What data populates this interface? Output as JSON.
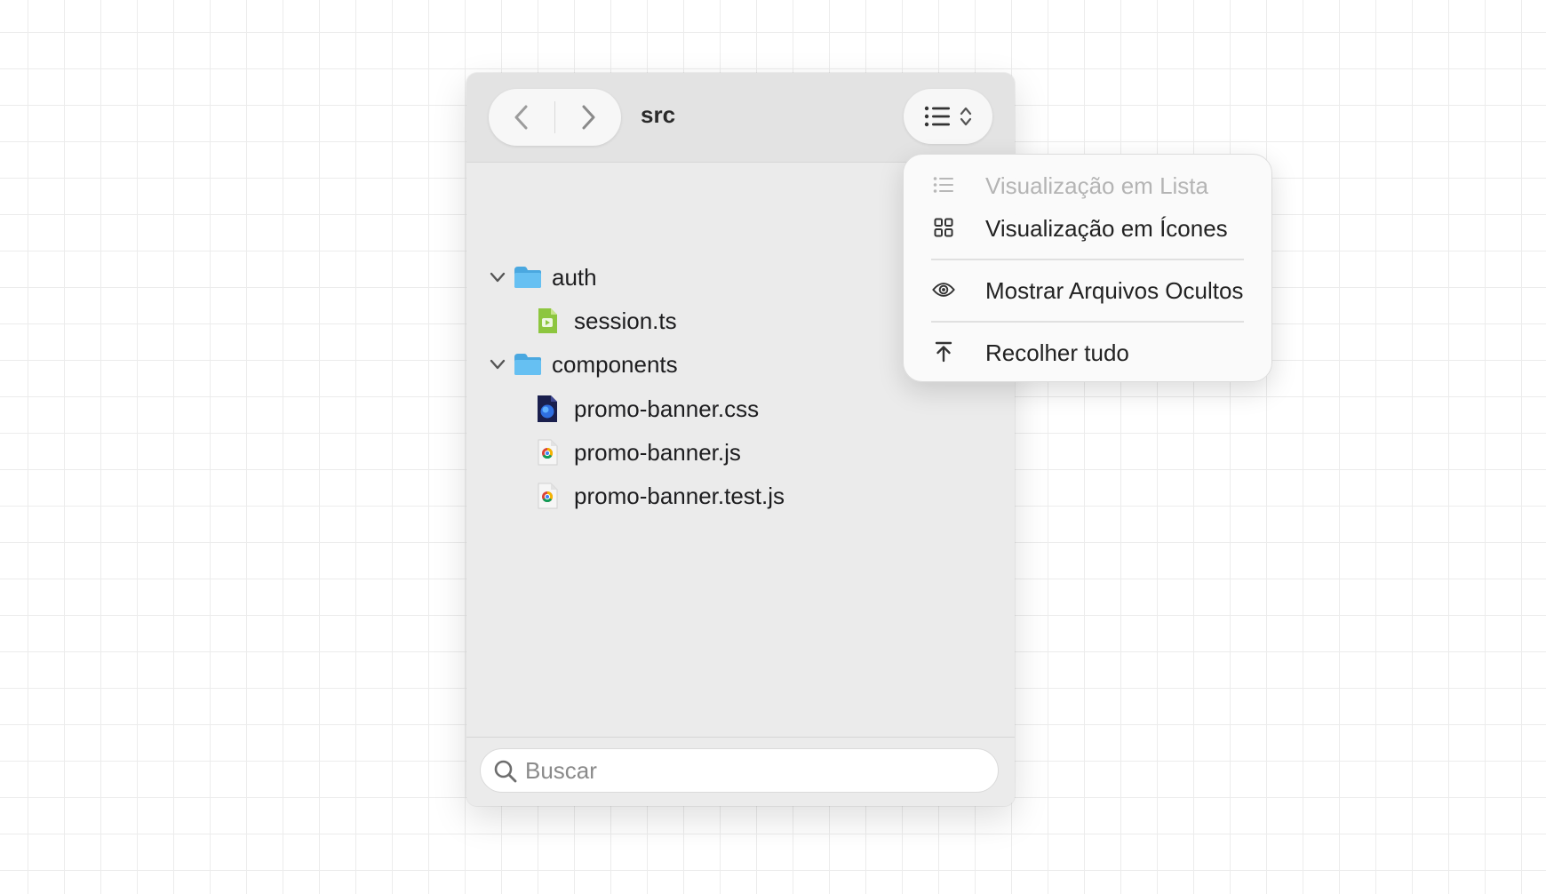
{
  "toolbar": {
    "title": "src",
    "back_icon": "chevron-left-icon",
    "forward_icon": "chevron-right-icon",
    "view_button_icon": "list-view-icon"
  },
  "tree": {
    "items": [
      {
        "type": "folder",
        "label": "auth",
        "expanded": true,
        "depth": 0
      },
      {
        "type": "file",
        "label": "session.ts",
        "icon": "typescript-file-icon",
        "depth": 1
      },
      {
        "type": "folder",
        "label": "components",
        "expanded": true,
        "depth": 0
      },
      {
        "type": "file",
        "label": "promo-banner.css",
        "icon": "css-file-icon",
        "depth": 1
      },
      {
        "type": "file",
        "label": "promo-banner.js",
        "icon": "js-file-icon",
        "depth": 1
      },
      {
        "type": "file",
        "label": "promo-banner.test.js",
        "icon": "js-file-icon",
        "depth": 1
      }
    ]
  },
  "search": {
    "placeholder": "Buscar",
    "value": ""
  },
  "view_menu": {
    "items": [
      {
        "label": "Visualização em Lista",
        "icon": "list-icon",
        "disabled": true
      },
      {
        "label": "Visualização em Ícones",
        "icon": "grid-icon",
        "disabled": false
      },
      {
        "label": "Mostrar Arquivos Ocultos",
        "icon": "eye-icon",
        "disabled": false
      },
      {
        "label": "Recolher tudo",
        "icon": "collapse-up-icon",
        "disabled": false
      }
    ]
  },
  "colors": {
    "folder_blue": "#5bb8ec",
    "ts_green": "#8dc63f",
    "css_navy": "#1a1f4d",
    "disabled_text": "#b4b4b4"
  }
}
